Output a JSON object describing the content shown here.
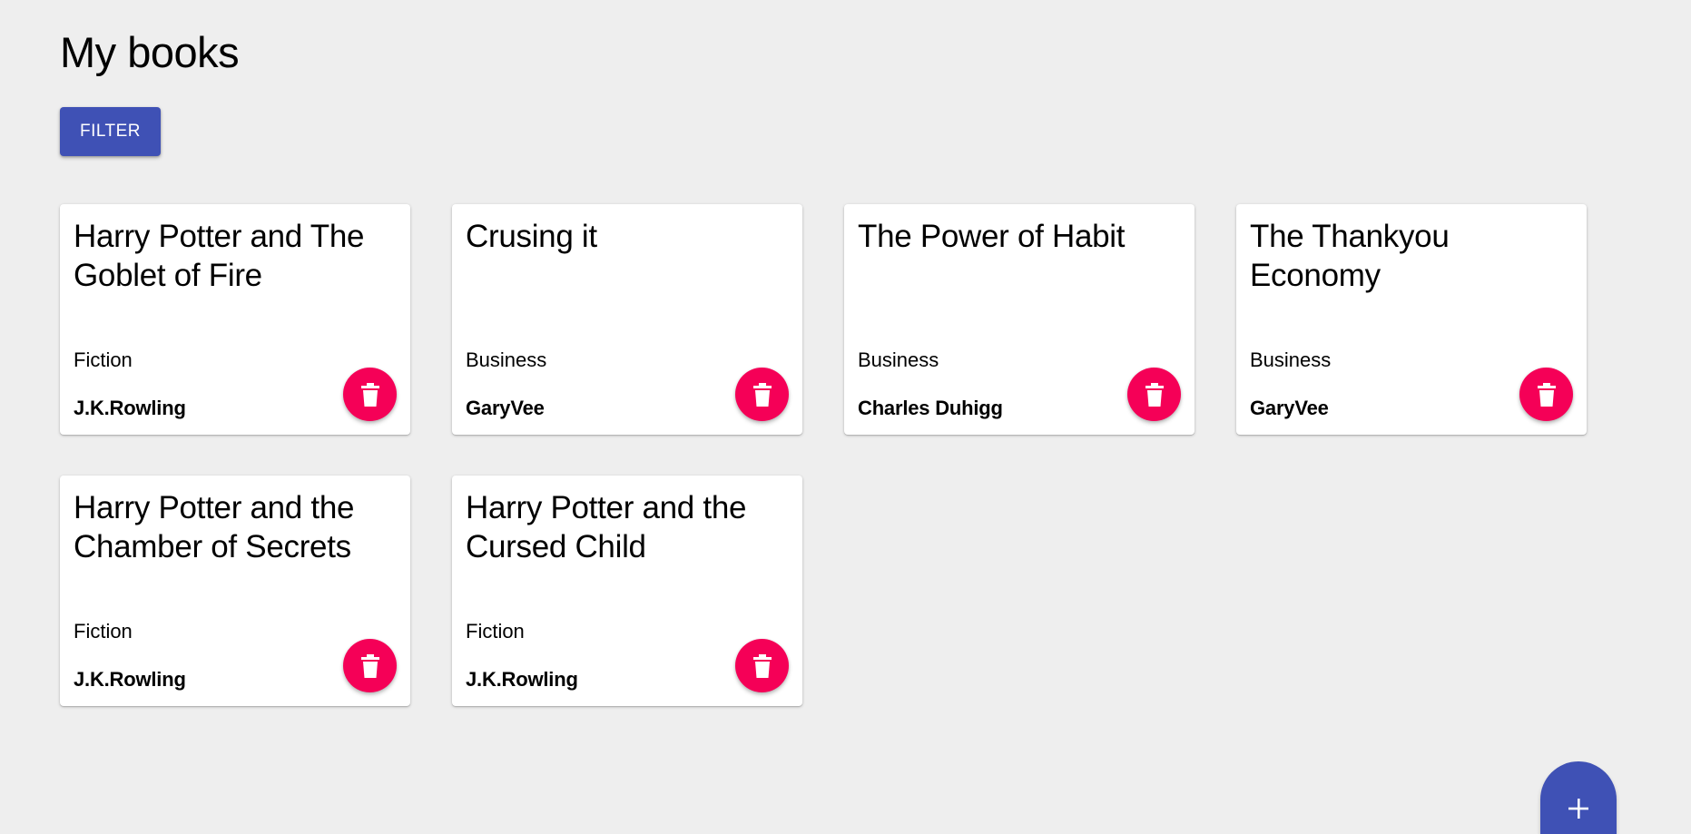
{
  "header": {
    "title": "My books",
    "filter_label": "FILTER"
  },
  "books": [
    {
      "title": "Harry Potter and The Goblet of Fire",
      "genre": "Fiction",
      "author": "J.K.Rowling"
    },
    {
      "title": "Crusing it",
      "genre": "Business",
      "author": "GaryVee"
    },
    {
      "title": "The Power of Habit",
      "genre": "Business",
      "author": "Charles Duhigg"
    },
    {
      "title": "The Thankyou Economy",
      "genre": "Business",
      "author": "GaryVee"
    },
    {
      "title": "Harry Potter and the Chamber of Secrets",
      "genre": "Fiction",
      "author": "J.K.Rowling"
    },
    {
      "title": "Harry Potter and the Cursed Child",
      "genre": "Fiction",
      "author": "J.K.Rowling"
    }
  ],
  "icons": {
    "delete": "trash-icon",
    "add": "plus-icon"
  },
  "colors": {
    "primary": "#3f51b5",
    "secondary": "#f50057",
    "background": "#eeeeee",
    "card": "#ffffff"
  }
}
